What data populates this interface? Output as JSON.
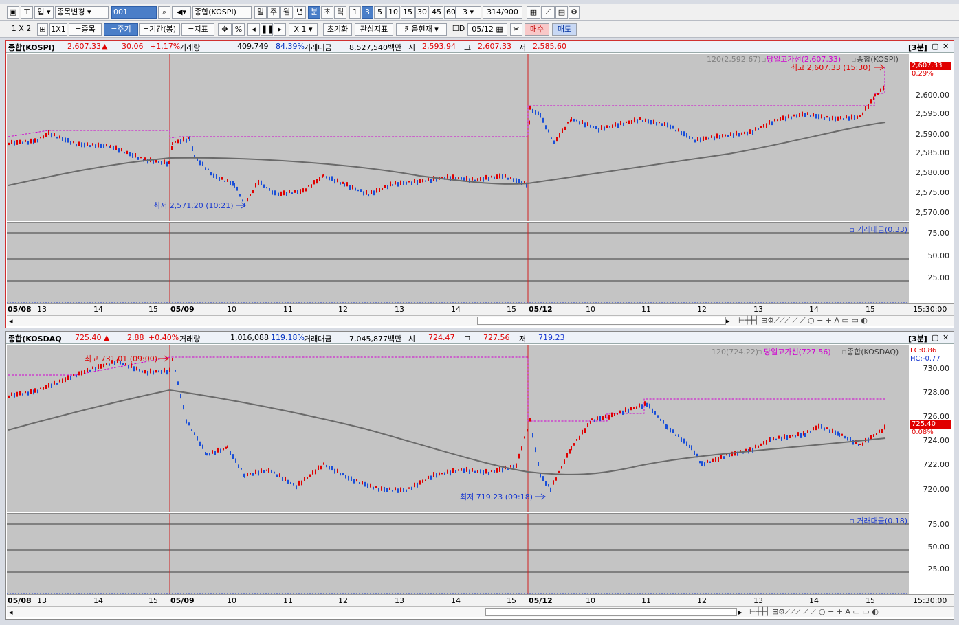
{
  "toolbar1": {
    "market": "업",
    "change_item": "종목변경",
    "code": "001",
    "index_name": "종합(KOSPI)",
    "periods": [
      "일",
      "주",
      "월",
      "년",
      "분",
      "초",
      "틱"
    ],
    "active_period": "분",
    "minutes": [
      "1",
      "3",
      "5",
      "10",
      "15",
      "30",
      "45",
      "60"
    ],
    "active_minute": "3",
    "minute_select": "3",
    "count": "314",
    "count_total": "/900"
  },
  "toolbar2": {
    "layout": "1 X 2",
    "ratio": "1X1",
    "item_btn": "=종목",
    "period_btn": "=주기",
    "range_btn": "=기간(봉)",
    "indicator_btn": "=지표",
    "percent": "%",
    "zoom": "X 1",
    "reset": "초기화",
    "interest": "관심지표",
    "kiwoom": "키움현재",
    "check_label": "D",
    "date": "05/12",
    "buy": "매수",
    "sell": "매도"
  },
  "kospi": {
    "name": "종합(KOSPI)",
    "price": "2,607.33",
    "arrow": "▲",
    "change": "30.06",
    "change_pct": "+1.17%",
    "vol_label": "거래량",
    "volume": "409,749",
    "vol_pct": "84.39%",
    "amt_label": "거래대금",
    "amount": "8,527,540백만",
    "open_label": "시",
    "open": "2,593.94",
    "high_label": "고",
    "high": "2,607.33",
    "low_label": "저",
    "low": "2,585.60",
    "interval": "[3분]",
    "legend_ma": "120(2,592.67)",
    "legend_line": "당일고가선(2,607.33)",
    "legend_name": "종합(KOSPI)",
    "max_label": "최고 2,607.33 (15:30)",
    "min_label": "최저 2,571.20 (10:21)",
    "price_tag": "2,607.33",
    "pct_tag": "0.29%",
    "yticks": [
      "2,600.00",
      "2,595.00",
      "2,590.00",
      "2,585.00",
      "2,580.00",
      "2,575.00",
      "2,570.00"
    ],
    "sub_label": "거래대금(0.33)",
    "sub_ticks": [
      "75.00",
      "50.00",
      "25.00"
    ]
  },
  "kosdaq": {
    "name": "종합(KOSDAQ",
    "price": "725.40",
    "arrow": "▲",
    "change": "2.88",
    "change_pct": "+0.40%",
    "vol_label": "거래량",
    "volume": "1,016,088",
    "vol_pct": "119.18%",
    "amt_label": "거래대금",
    "amount": "7,045,877백만",
    "open_label": "시",
    "open": "724.47",
    "high_label": "고",
    "high": "727.56",
    "low_label": "저",
    "low": "719.23",
    "interval": "[3분]",
    "legend_ma": "120(724.22)",
    "legend_line": "당일고가선(727.56)",
    "legend_name": "종합(KOSDAQ)",
    "max_label": "최고 731.01 (09:00)",
    "min_label": "최저 719.23 (09:18)",
    "lc": "LC:0.86",
    "hc": "HC:-0.77",
    "price_tag": "725.40",
    "pct_tag": "0.08%",
    "yticks": [
      "730.00",
      "728.00",
      "726.00",
      "724.00",
      "722.00",
      "720.00"
    ],
    "sub_label": "거래대금(0.18)",
    "sub_ticks": [
      "75.00",
      "50.00",
      "25.00"
    ]
  },
  "xaxis": [
    "05/08",
    "13",
    "14",
    "15",
    "05/09",
    "10",
    "11",
    "12",
    "13",
    "14",
    "15",
    "05/12",
    "10",
    "11",
    "12",
    "13",
    "14",
    "15"
  ],
  "time_label": "15:30:00",
  "colors": {
    "up": "#e00000",
    "down": "#1a4fd8",
    "ma": "#6a6a6a",
    "highline": "#d000d0",
    "session": "#d02020"
  }
}
